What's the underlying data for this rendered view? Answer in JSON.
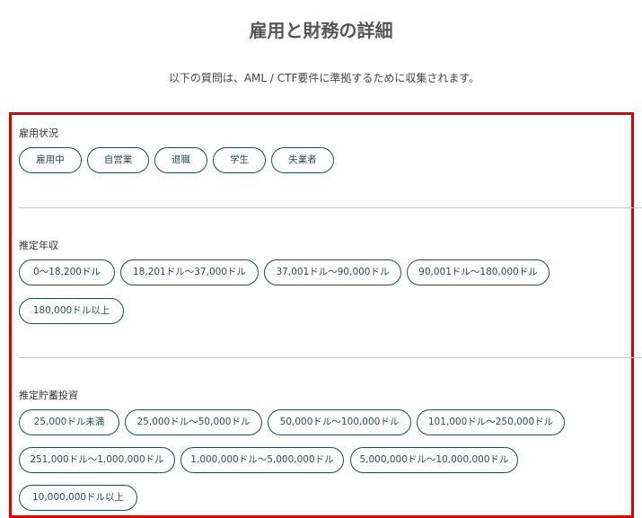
{
  "header": {
    "title": "雇用と財務の詳細",
    "subtitle": "以下の質問は、AML / CTF要件に準拠するために収集されます。"
  },
  "sections": [
    {
      "label": "雇用状況",
      "options": [
        "雇用中",
        "自営業",
        "退職",
        "学生",
        "失業者"
      ]
    },
    {
      "label": "推定年収",
      "options": [
        "0～18,200ドル",
        "18,201ドル～37,000ドル",
        "37,001ドル～90,000ドル",
        "90,001ドル～180,000ドル",
        "180,000ドル以上"
      ]
    },
    {
      "label": "推定貯蓄投資",
      "options": [
        "25,000ドル未満",
        "25,000ドル～50,000ドル",
        "50,000ドル～100,000ドル",
        "101,000ドル～250,000ドル",
        "251,000ドル～1,000,000ドル",
        "1,000,000ドル～5,000,000ドル",
        "5,000,000ドル～10,000,000ドル",
        "10,000,000ドル以上"
      ]
    }
  ],
  "colors": {
    "accent": "#1f4f5c",
    "highlight_border": "#e00000",
    "divider": "#c8c8c8"
  }
}
